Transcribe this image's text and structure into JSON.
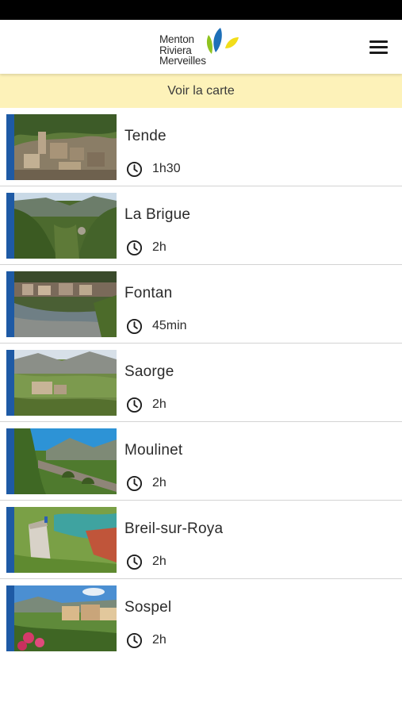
{
  "header": {
    "logo_lines": [
      "Menton",
      "Riviera",
      "Merveilles"
    ],
    "menu_icon": "hamburger-menu-icon"
  },
  "map_link": {
    "label": "Voir la carte"
  },
  "colors": {
    "accent": "#1e5aa5",
    "map_bar": "#fdf2b9",
    "logo_blue": "#1d6fb8",
    "logo_green": "#8fc31f",
    "logo_yellow": "#f2dd1a"
  },
  "routes": [
    {
      "name": "Tende",
      "duration": "1h30",
      "icon": "clock-icon"
    },
    {
      "name": "La Brigue",
      "duration": "2h",
      "icon": "clock-icon"
    },
    {
      "name": "Fontan",
      "duration": "45min",
      "icon": "clock-icon"
    },
    {
      "name": "Saorge",
      "duration": "2h",
      "icon": "clock-icon"
    },
    {
      "name": "Moulinet",
      "duration": "2h",
      "icon": "clock-icon"
    },
    {
      "name": "Breil-sur-Roya",
      "duration": "2h",
      "icon": "clock-icon"
    },
    {
      "name": "Sospel",
      "duration": "2h",
      "icon": "clock-icon"
    }
  ]
}
